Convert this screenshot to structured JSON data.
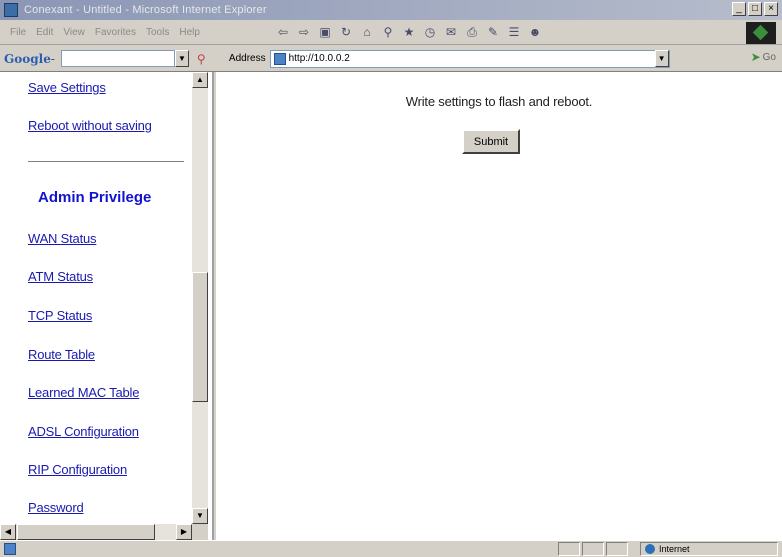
{
  "window": {
    "title": "Conexant - Untitled - Microsoft Internet Explorer",
    "controls": [
      "_",
      "□",
      "×"
    ]
  },
  "menubar": {
    "items": [
      "File",
      "Edit",
      "View",
      "Favorites",
      "Tools",
      "Help"
    ],
    "nav_icons": [
      "back-icon",
      "forward-icon",
      "stop-icon",
      "refresh-icon",
      "home-icon",
      "search-icon",
      "favorites-icon",
      "history-icon",
      "mail-icon",
      "print-icon",
      "edit-icon",
      "discuss-icon",
      "messenger-icon"
    ]
  },
  "addressbar": {
    "google_label": "Google",
    "google_sep": "-",
    "address_label": "Address",
    "address_value": "http://10.0.0.2",
    "go_label": "Go"
  },
  "sidebar": {
    "links_top": [
      "Save Settings",
      "Reboot without saving"
    ],
    "section_title": "Admin Privilege",
    "links": [
      "WAN Status",
      "ATM Status",
      "TCP Status",
      "Route Table",
      "Learned MAC Table",
      "ADSL Configuration",
      "RIP Configuration",
      "Password"
    ]
  },
  "main": {
    "message": "Write settings to flash and reboot.",
    "submit_label": "Submit"
  },
  "statusbar": {
    "zone_label": "Internet"
  },
  "colors": {
    "link": "#1a1ab0",
    "section_title": "#1212d0",
    "chrome": "#d4d0c8"
  }
}
